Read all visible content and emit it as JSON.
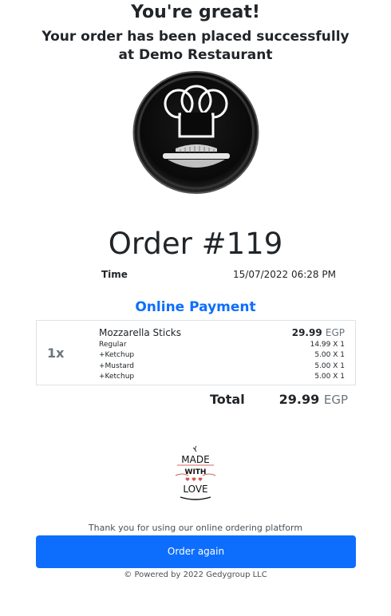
{
  "header": {
    "title": "You're great!",
    "message": "Your order has been placed successfully at Demo Restaurant"
  },
  "restaurant": {
    "logo_icon": "chef-hat-icon"
  },
  "order": {
    "number_label": "Order #119",
    "time_label": "Time",
    "time_value": "15/07/2022 06:28 PM",
    "payment_method": "Online Payment",
    "items": [
      {
        "qty": "1x",
        "name": "Mozzarella Sticks",
        "price": "29.99",
        "currency": "EGP",
        "lines": [
          {
            "label": "Regular",
            "price": "14.99 X 1"
          },
          {
            "label": "+Ketchup",
            "price": "5.00 X 1"
          },
          {
            "label": "+Mustard",
            "price": "5.00 X 1"
          },
          {
            "label": "+Ketchup",
            "price": "5.00 X 1"
          }
        ]
      }
    ],
    "total_label": "Total",
    "total_value": "29.99",
    "total_currency": "EGP"
  },
  "badge": {
    "icon": "made-with-love-icon",
    "line1": "MADE",
    "line2": "WITH",
    "line3": "LOVE"
  },
  "footer": {
    "thanks": "Thank you for using our online ordering platform",
    "button_label": "Order again",
    "powered": "© Powered by 2022 Gedygroup LLC"
  },
  "colors": {
    "accent": "#0d6efd",
    "text": "#212529",
    "muted": "#6c757d"
  }
}
